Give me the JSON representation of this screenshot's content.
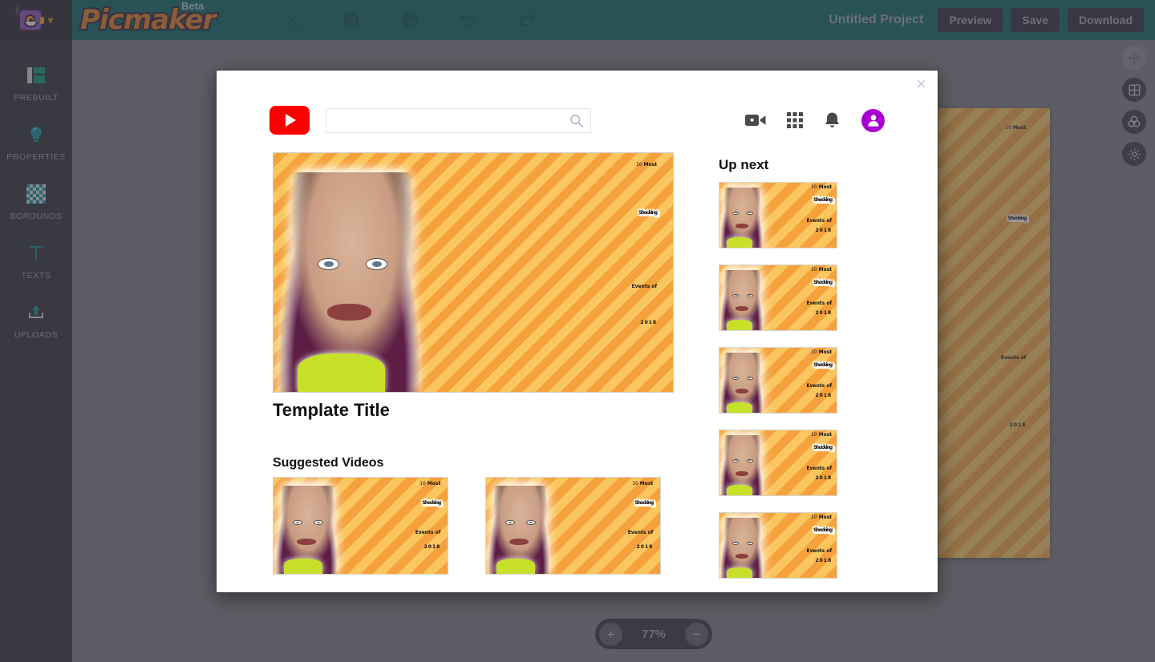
{
  "app": {
    "brand": {
      "name": "Picmaker",
      "badge": "Beta",
      "avatar_icon": "robot-avatar-icon",
      "chevron_icon": "chevron-down-icon"
    },
    "accent_color": "#056360",
    "header_btn_color": "#2a2736",
    "canvas_bg": "#7a7a80"
  },
  "toolbar": {
    "tools": [
      {
        "name": "cut",
        "icon": "scissors-icon"
      },
      {
        "name": "copy",
        "icon": "copy-icon"
      },
      {
        "name": "paste",
        "icon": "paste-icon"
      },
      {
        "name": "undo",
        "icon": "undo-icon"
      },
      {
        "name": "redo",
        "icon": "redo-icon"
      }
    ],
    "project_name": "Untitled Project",
    "preview_label": "Preview",
    "save_label": "Save",
    "download_label": "Download"
  },
  "sidebar": {
    "items": [
      {
        "label": "PREBUILT",
        "icon": "layout-grid-icon"
      },
      {
        "label": "PROPERTIES",
        "icon": "lightbulb-icon"
      },
      {
        "label": "BGROUNDS",
        "icon": "checkerboard-icon"
      },
      {
        "label": "TEXTS",
        "icon": "text-t-icon"
      },
      {
        "label": "UPLOADS",
        "icon": "upload-icon"
      }
    ]
  },
  "right_rail": {
    "items": [
      {
        "name": "pan-move",
        "icon": "move-arrows-icon"
      },
      {
        "name": "grid",
        "icon": "grid-panels-icon"
      },
      {
        "name": "colors",
        "icon": "color-circles-icon"
      },
      {
        "name": "settings",
        "icon": "gear-icon"
      }
    ]
  },
  "zoom_control": {
    "increase_label": "+",
    "value": "77%",
    "decrease_label": "−"
  },
  "modal": {
    "close_label": "×",
    "youtube": {
      "logo_icon": "youtube-play-icon",
      "search_value": "",
      "search_placeholder": "",
      "search_icon": "magnifier-icon",
      "actions": [
        {
          "name": "create-video",
          "icon": "video-add-icon"
        },
        {
          "name": "apps",
          "icon": "apps-grid-icon"
        },
        {
          "name": "notifications",
          "icon": "bell-icon"
        },
        {
          "name": "account",
          "icon": "avatar-icon"
        }
      ]
    },
    "video_title": "Template Title",
    "suggested_heading": "Suggested Videos",
    "up_next_heading": "Up next",
    "thumbnail": {
      "line1_prefix": "10 ",
      "line1_bold": "Most",
      "line2": "Shocking",
      "line3": "Events of",
      "line4": "2018"
    },
    "suggested_count": 2,
    "up_next_count": 5
  }
}
